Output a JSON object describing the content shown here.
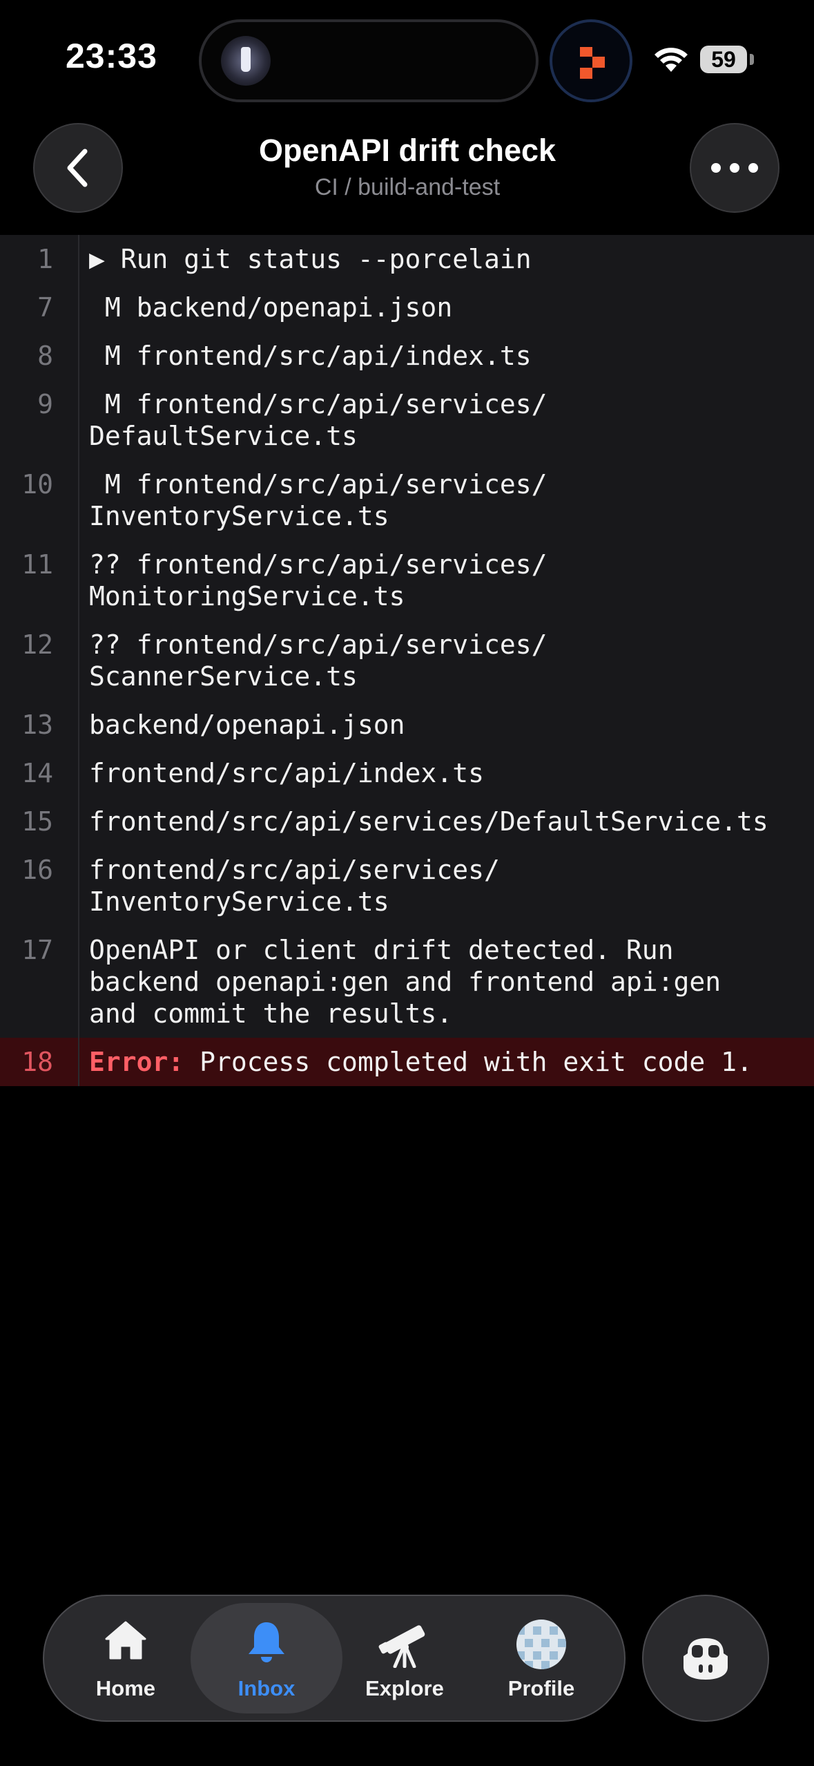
{
  "status": {
    "time": "23:33",
    "battery": "59"
  },
  "header": {
    "title": "OpenAPI drift check",
    "subtitle": "CI / build-and-test"
  },
  "log": {
    "lines": [
      {
        "n": "1",
        "text": "▶ Run git status --porcelain"
      },
      {
        "n": "7",
        "text": " M backend/openapi.json"
      },
      {
        "n": "8",
        "text": " M frontend/src/api/index.ts"
      },
      {
        "n": "9",
        "text": " M frontend/src/api/services/\nDefaultService.ts"
      },
      {
        "n": "10",
        "text": " M frontend/src/api/services/\nInventoryService.ts"
      },
      {
        "n": "11",
        "text": "?? frontend/src/api/services/\nMonitoringService.ts"
      },
      {
        "n": "12",
        "text": "?? frontend/src/api/services/\nScannerService.ts"
      },
      {
        "n": "13",
        "text": "backend/openapi.json"
      },
      {
        "n": "14",
        "text": "frontend/src/api/index.ts"
      },
      {
        "n": "15",
        "text": "frontend/src/api/services/DefaultService.ts"
      },
      {
        "n": "16",
        "text": "frontend/src/api/services/\nInventoryService.ts"
      },
      {
        "n": "17",
        "text": "OpenAPI or client drift detected. Run\nbackend openapi:gen and frontend api:gen\nand commit the results."
      }
    ],
    "error": {
      "n": "18",
      "label": "Error:",
      "message": " Process completed with exit code 1."
    }
  },
  "tabs": {
    "home": "Home",
    "inbox": "Inbox",
    "explore": "Explore",
    "profile": "Profile",
    "active": "inbox"
  },
  "colors": {
    "accent": "#3d8ef7",
    "error": "#ff5f66",
    "errorBg": "#3a0b0e"
  },
  "icons": [
    "flashlight-icon",
    "app-activity-icon",
    "wifi-icon",
    "chevron-left-icon",
    "ellipsis-icon",
    "home-icon",
    "bell-icon",
    "telescope-icon",
    "avatar",
    "copilot-icon"
  ]
}
